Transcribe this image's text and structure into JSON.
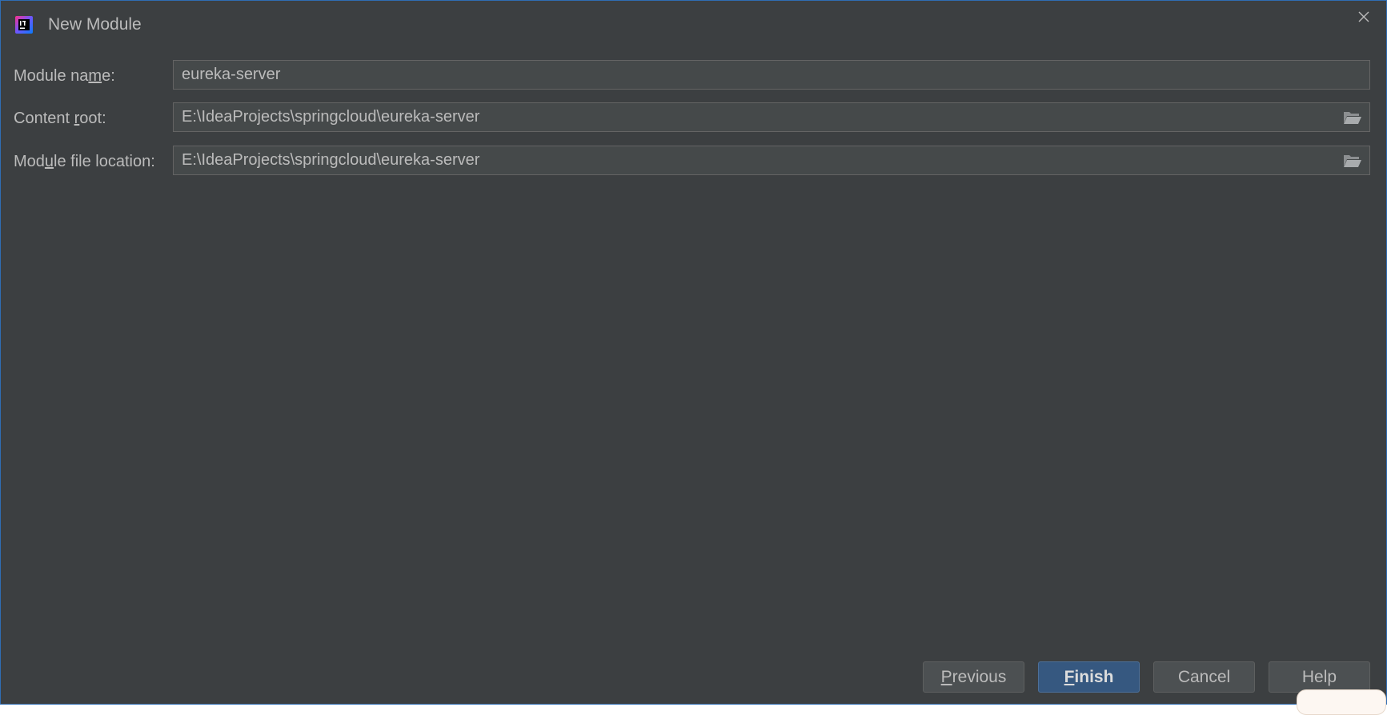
{
  "window": {
    "title": "New Module",
    "app_icon": "intellij-idea-icon",
    "close_icon": "close-icon"
  },
  "form": {
    "module_name": {
      "label_pre": "Module na",
      "label_mnemonic": "m",
      "label_post": "e:",
      "value": "eureka-server"
    },
    "content_root": {
      "label_pre": "Content ",
      "label_mnemonic": "r",
      "label_post": "oot:",
      "value": "E:\\IdeaProjects\\springcloud\\eureka-server",
      "browse_icon": "folder-icon"
    },
    "module_file_location": {
      "label_pre": "Mod",
      "label_mnemonic": "u",
      "label_post": "le file location:",
      "value": "E:\\IdeaProjects\\springcloud\\eureka-server",
      "browse_icon": "folder-icon"
    }
  },
  "buttons": {
    "previous": {
      "mnemonic": "P",
      "rest": "revious"
    },
    "finish": {
      "mnemonic": "F",
      "rest": "inish"
    },
    "cancel": "Cancel",
    "help": "Help"
  },
  "colors": {
    "background": "#3c3f41",
    "field_background": "#45494a",
    "text": "#bbbbbb",
    "primary_button": "#365880",
    "border_accent": "#2f6db3"
  }
}
